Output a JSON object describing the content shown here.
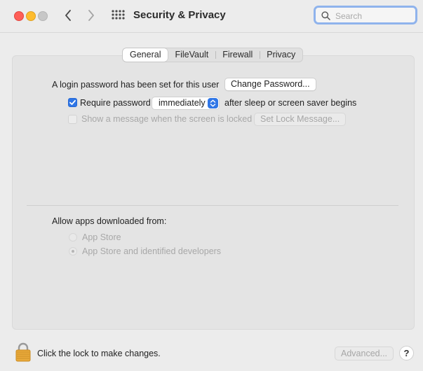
{
  "window": {
    "title": "Security & Privacy",
    "search_placeholder": "Search"
  },
  "tabs": [
    {
      "label": "General",
      "active": true
    },
    {
      "label": "FileVault",
      "active": false
    },
    {
      "label": "Firewall",
      "active": false
    },
    {
      "label": "Privacy",
      "active": false
    }
  ],
  "general": {
    "login_text": "A login password has been set for this user",
    "change_password_button": "Change Password...",
    "require_password_label": "Require password",
    "require_password_checked": true,
    "require_password_delay": "immediately",
    "after_sleep_text": "after sleep or screen saver begins",
    "show_message_label": "Show a message when the screen is locked",
    "show_message_checked": false,
    "set_lock_message_button": "Set Lock Message...",
    "allow_apps_label": "Allow apps downloaded from:",
    "allow_options": [
      "App Store",
      "App Store and identified developers"
    ],
    "allow_selected": "App Store and identified developers"
  },
  "footer": {
    "lock_text": "Click the lock to make changes.",
    "advanced_button": "Advanced...",
    "help_button": "?"
  },
  "colors": {
    "accent": "#2f76e6",
    "close": "#fe5f57",
    "minimize": "#febc2e",
    "search_focus": "#8fb3ec"
  }
}
